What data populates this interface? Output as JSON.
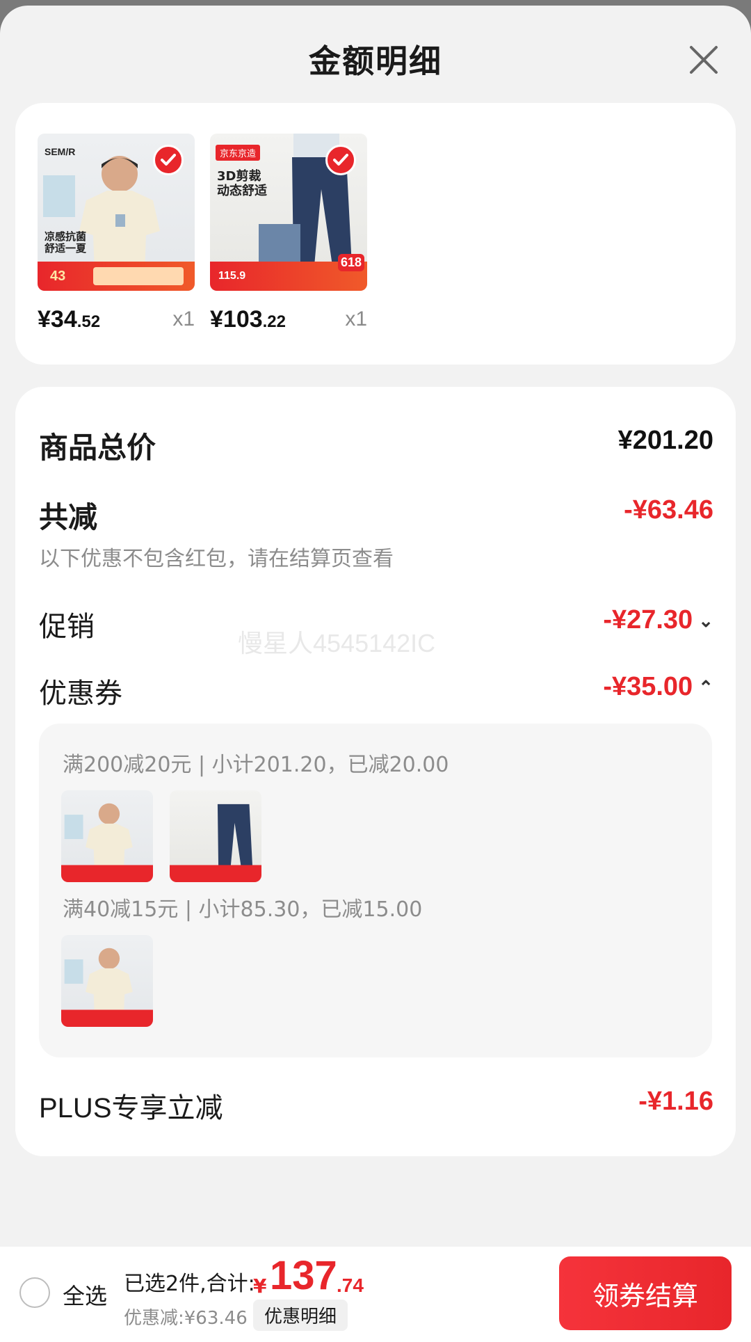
{
  "header": {
    "title": "金额明细"
  },
  "products": [
    {
      "price_int": "¥34",
      "price_dec": ".52",
      "qty": "x1",
      "brand": "SEM/R",
      "ad_text": "凉感抗菌\n舒适一夏",
      "promo_price": "43"
    },
    {
      "price_int": "¥103",
      "price_dec": ".22",
      "qty": "x1",
      "brand": "京东京造",
      "ad_text": "3D剪裁\n动态舒适",
      "promo_price": "115.9",
      "badge": "618"
    }
  ],
  "summary": {
    "total_label": "商品总价",
    "total_value": "¥201.20",
    "reduce_label": "共减",
    "reduce_value": "-¥63.46",
    "note": "以下优惠不包含红包，请在结算页查看",
    "promo_label": "促销",
    "promo_value": "-¥27.30",
    "coupon_label": "优惠券",
    "coupon_value": "-¥35.00",
    "watermark": "慢星人4545142IC",
    "coupon_lines": [
      "满200减20元 | 小计201.20，已减20.00",
      "满40减15元 | 小计85.30，已减15.00"
    ],
    "plus_label": "PLUS专享立减",
    "plus_value": "-¥1.16"
  },
  "footer": {
    "select_all": "全选",
    "selected_text": "已选2件,合计:",
    "total_currency": "¥",
    "total_int": "137",
    "total_dec": ".74",
    "discount_text": "优惠减:¥63.46",
    "detail_button": "优惠明细",
    "checkout_button": "领券结算"
  },
  "colors": {
    "accent": "#e8262b",
    "background": "#f2f2f2"
  }
}
